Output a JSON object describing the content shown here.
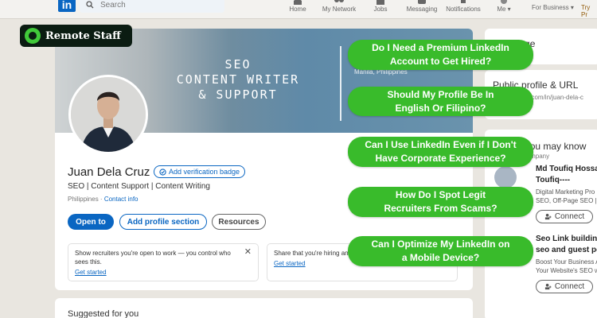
{
  "nav": {
    "search_placeholder": "Search",
    "items": [
      "Home",
      "My Network",
      "Jobs",
      "Messaging",
      "Notifications",
      "Me"
    ],
    "business": "For Business",
    "try": "Try Pr"
  },
  "profile": {
    "banner_lines": [
      "SEO",
      "CONTENT WRITER",
      "& SUPPORT"
    ],
    "banner_location": "Manila, Philippines",
    "name": "Juan Dela Cruz",
    "verify_badge": "Add verification badge",
    "headline": "SEO | Content Support | Content Writing",
    "location": "Philippines",
    "contact_info": "Contact info",
    "buttons": {
      "open": "Open to",
      "add": "Add profile section",
      "resources": "Resources"
    },
    "box1": {
      "text": "Show recruiters you're open to work — you control who sees this.",
      "link": "Get started",
      "close": "✕"
    },
    "box2": {
      "text": "Share that you're hiring and attract qualified candidates.",
      "link": "Get started"
    }
  },
  "suggested": {
    "title": "Suggested for you"
  },
  "right": {
    "language_title": "Language",
    "public_title": "Public profile & URL",
    "public_url": "www.linkedin.com/in/juan-dela-c",
    "may_know_title": "People you may know",
    "may_know_sub": "From your company",
    "person1": {
      "name": "Md Toufiq Hossain",
      "name2": "Toufiq----",
      "line1": "Digital Marketing Pro",
      "line2": "SEO, Off-Page SEO | B"
    },
    "person2": {
      "name": "Seo Link building c",
      "name2": "seo and guest post",
      "line1": "Boost Your Business A",
      "line2": "Your Website's SEO wi"
    },
    "connect": "Connect"
  },
  "faqs": [
    "Do I Need a Premium LinkedIn Account to Get Hired?",
    "Should My Profile Be In English Or Filipino?",
    "Can I Use LinkedIn Even if I Don't Have Corporate Experience?",
    "How Do I Spot Legit Recruiters From Scams?",
    "Can I Optimize My LinkedIn on a Mobile Device?"
  ],
  "brand": {
    "name": "Remote Staff",
    "accent": "#39bb2b"
  }
}
